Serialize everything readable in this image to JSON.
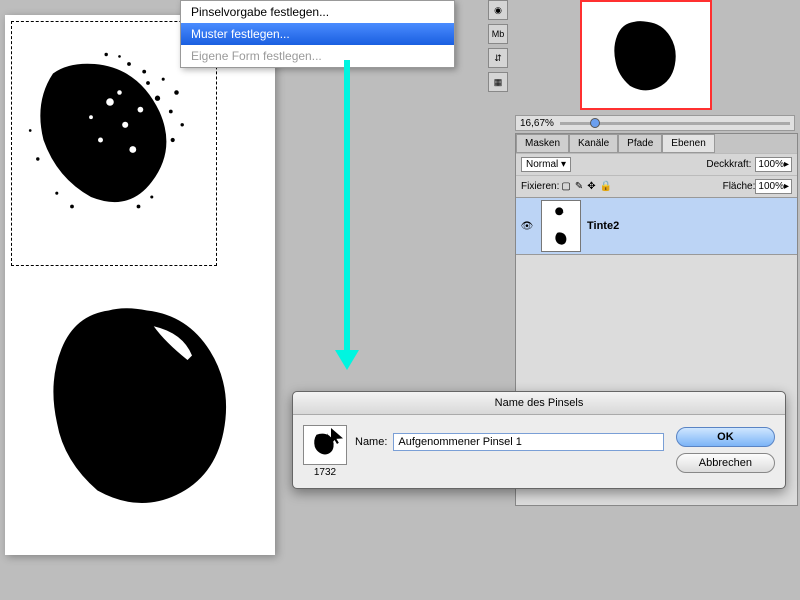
{
  "context_menu": {
    "items": [
      {
        "label": "Pinselvorgabe festlegen...",
        "state": "normal"
      },
      {
        "label": "Muster festlegen...",
        "state": "highlighted"
      },
      {
        "label": "Eigene Form festlegen...",
        "state": "disabled"
      }
    ]
  },
  "navigator": {
    "zoom": "16,67%"
  },
  "layers_panel": {
    "tabs": [
      "Masken",
      "Kanäle",
      "Pfade",
      "Ebenen"
    ],
    "active_tab": "Ebenen",
    "blend_mode": "Normal",
    "opacity_label": "Deckkraft:",
    "opacity_value": "100%",
    "lock_label": "Fixieren:",
    "fill_label": "Fläche:",
    "fill_value": "100%",
    "layer_name": "Tinte2"
  },
  "dialog": {
    "title": "Name des Pinsels",
    "name_label": "Name:",
    "name_value": "Aufgenommener Pinsel 1",
    "brush_size": "1732",
    "ok": "OK",
    "cancel": "Abbrechen"
  },
  "tool_column": {
    "icons": [
      "◉",
      "Mb",
      "⇵",
      "▦"
    ]
  }
}
